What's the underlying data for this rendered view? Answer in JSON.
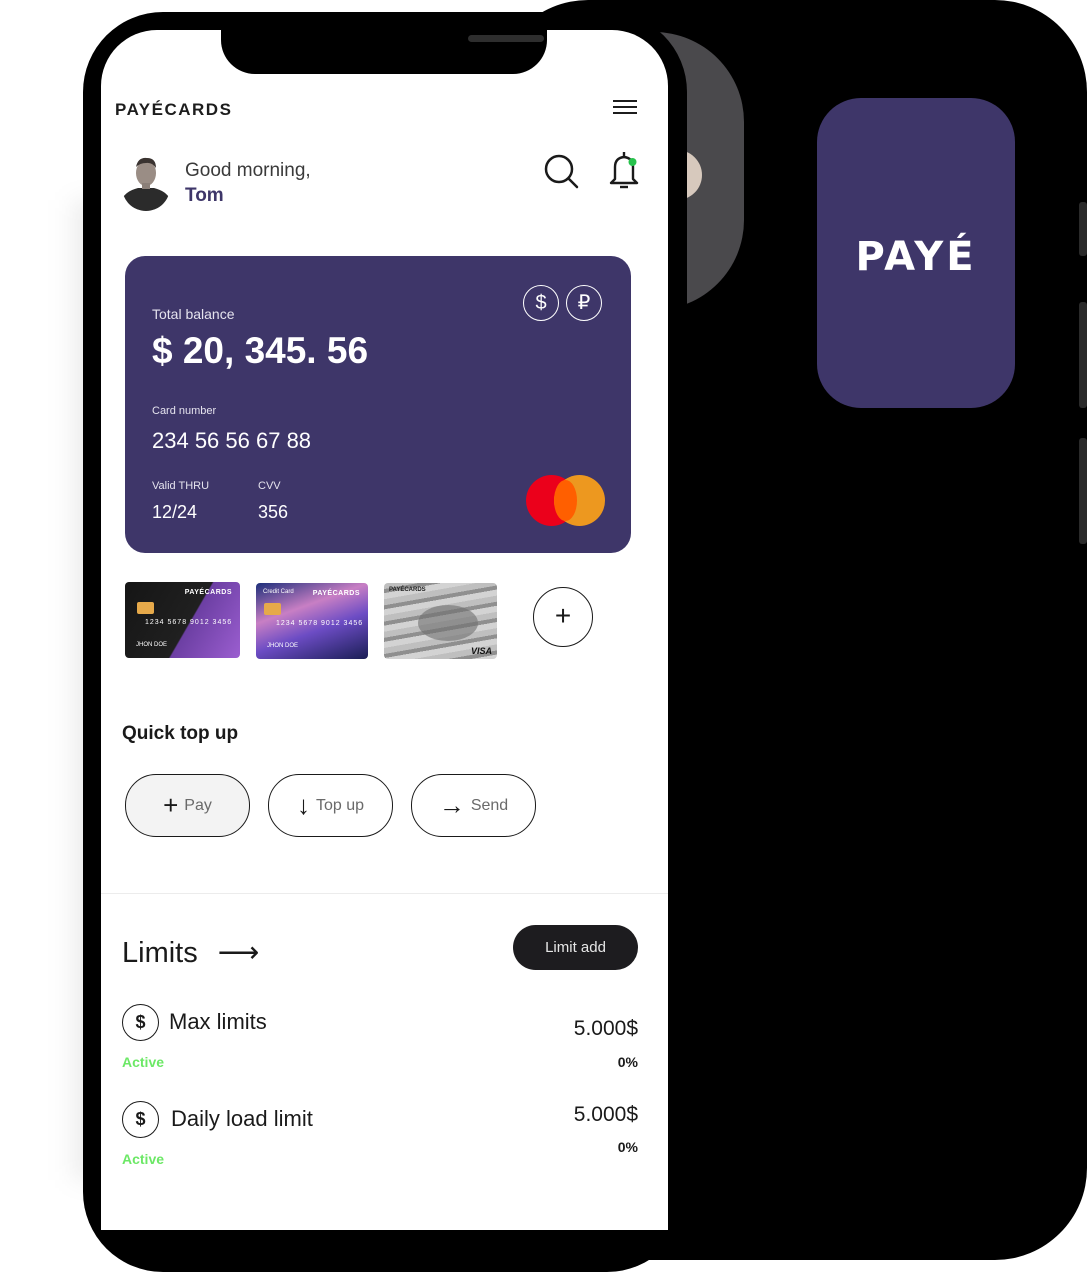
{
  "back_phone": {
    "logo": "PAYÉ"
  },
  "header": {
    "brand": "PAYÉCARDS"
  },
  "user": {
    "greeting": "Good morning,",
    "name": "Tom"
  },
  "balance_card": {
    "balance_label": "Total balance",
    "balance_value": "$ 20, 345. 56",
    "currency_usd": "$",
    "currency_rub": "₽",
    "card_number_label": "Card number",
    "card_number": "234 56 56 67 88",
    "valid_label": "Valid THRU",
    "valid_value": "12/24",
    "cvv_label": "CVV",
    "cvv_value": "356"
  },
  "mini_cards": [
    {
      "logo": "PAYÉCARDS",
      "number": "1234 5678 9012 3456",
      "holder": "JHON DOE"
    },
    {
      "logo": "PAYÉCARDS",
      "number": "1234 5678 9012 3456",
      "holder": "JHON DOE",
      "label": "Credit Card"
    },
    {
      "logo": "PAYÉCARDS",
      "brand": "VISA"
    }
  ],
  "add_card_symbol": "+",
  "quick_top_up": {
    "title": "Quick top up",
    "buttons": [
      {
        "icon": "+",
        "label": "Pay"
      },
      {
        "icon": "↓",
        "label": "Top up"
      },
      {
        "icon": "→",
        "label": "Send"
      }
    ]
  },
  "limits": {
    "title": "Limits",
    "arrow": "⟶",
    "add_label": "Limit add",
    "items": [
      {
        "icon": "$",
        "name": "Max limits",
        "status": "Active",
        "amount": "5.000$",
        "percent": "0%"
      },
      {
        "icon": "$",
        "name": "Daily load limit",
        "status": "Active",
        "amount": "5.000$",
        "percent": "0%"
      }
    ]
  },
  "colors": {
    "brand_purple": "#3e3669",
    "active_green": "#6ce866",
    "dark": "#1d1c1f"
  }
}
